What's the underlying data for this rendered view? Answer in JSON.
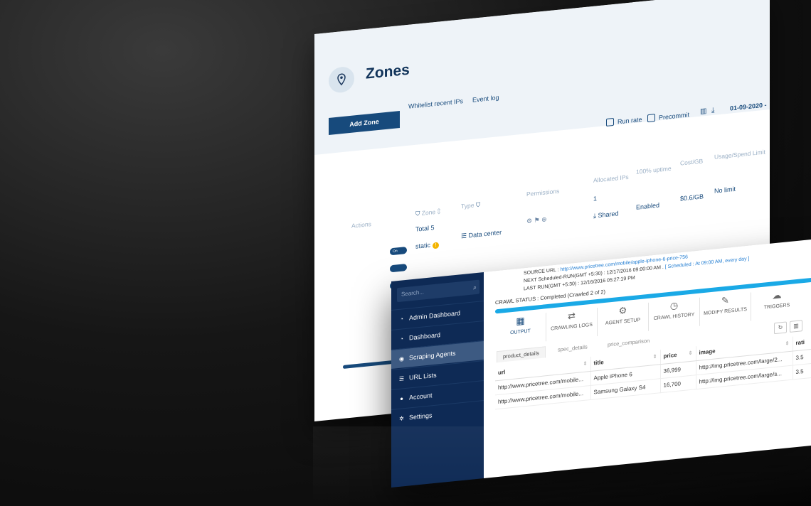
{
  "zones": {
    "title": "Zones",
    "add_button": "Add Zone",
    "tabs": [
      "Whitelist recent IPs",
      "Event log"
    ],
    "run_rate": "Run rate",
    "precommit": "Precommit",
    "date": "01-09-2020 -",
    "columns": {
      "actions": "Actions",
      "zone": "Zone",
      "type": "Type",
      "permissions": "Permissions",
      "allocated_ips": "Allocated IPs",
      "uptime": "100% uptime",
      "cost": "Cost/GB",
      "usage": "Usage/Spend Limit"
    },
    "total": "Total 5",
    "row1": {
      "zone": "static",
      "toggle": "On",
      "type": "Data center",
      "allocated": "1",
      "shared": "Shared",
      "uptime": "Enabled",
      "cost": "$0.6/GB",
      "limit": "No limit"
    }
  },
  "scraper": {
    "search_placeholder": "Search...",
    "nav": [
      {
        "label": "Admin Dashboard",
        "icon": "dashboard-icon"
      },
      {
        "label": "Dashboard",
        "icon": "dashboard-icon"
      },
      {
        "label": "Scraping Agents",
        "icon": "globe-icon",
        "active": true
      },
      {
        "label": "URL Lists",
        "icon": "list-icon"
      },
      {
        "label": "Account",
        "icon": "user-icon"
      },
      {
        "label": "Settings",
        "icon": "gear-icon"
      }
    ],
    "source_url_label": "SOURCE URL :",
    "source_url": "http://www.pricetree.com/mobile/apple-iphone-6-price-756",
    "next_run": "NEXT Scheduled-RUN(GMT +5:30) : 12/17/2016 09:00:00 AM .",
    "scheduled": "[ Scheduled : At 09:00 AM, every day ]",
    "last_run": "LAST RUN(GMT +5:30) : 12/16/2016 05:27:19 PM",
    "crawl_status": "CRAWL STATUS : Completed (Crawled 2 of 2)",
    "toolbar": [
      "OUTPUT",
      "CRAWLING LOGS",
      "AGENT SETUP",
      "CRAWL HISTORY",
      "MODIFY RESULTS",
      "TRIGGERS"
    ],
    "result_tabs": [
      "product_details",
      "spec_details",
      "price_comparison"
    ],
    "table": {
      "headers": [
        "url",
        "title",
        "price",
        "image",
        "rati"
      ],
      "rows": [
        [
          "http://www.pricetree.com/mobile...",
          "Apple iPhone 6",
          "36,999",
          "http://img.pricetree.com/large/2...",
          "3.5"
        ],
        [
          "http://www.pricetree.com/mobile...",
          "Samsung Galaxy S4",
          "16,700",
          "http://img.pricetree.com/large/s...",
          "3.5"
        ]
      ]
    }
  }
}
